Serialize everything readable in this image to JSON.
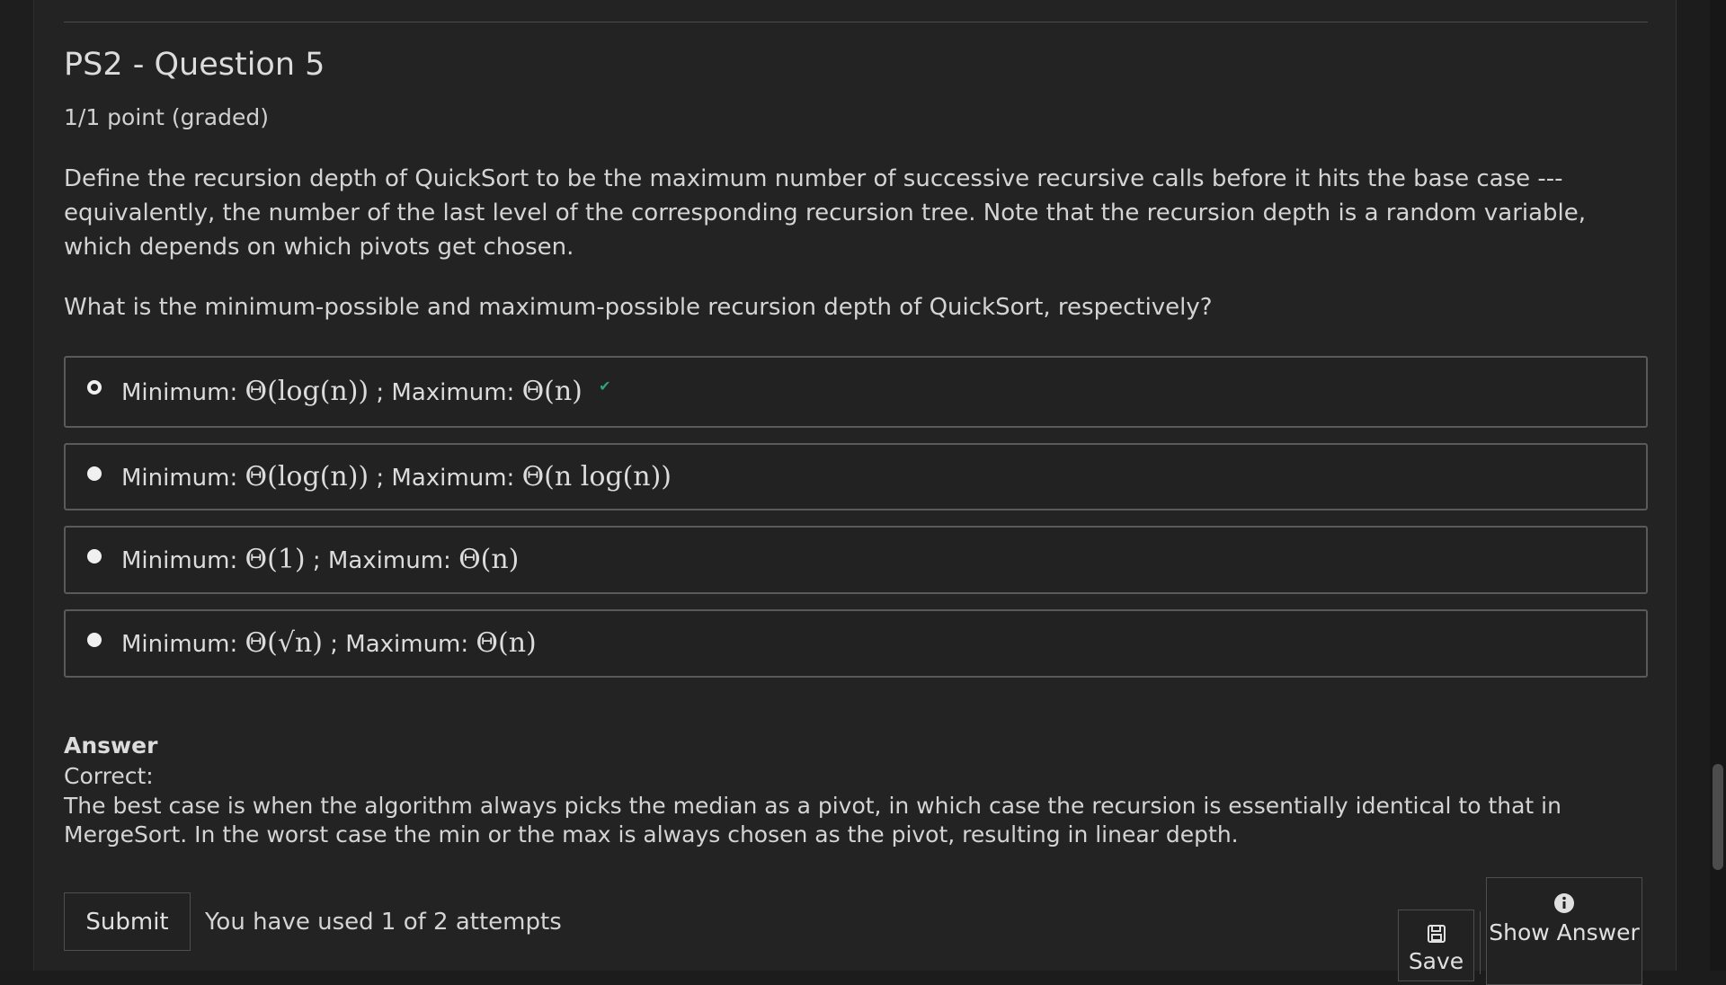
{
  "problem": {
    "title": "PS2 - Question 5",
    "score": "1/1 point (graded)",
    "prompt": "Define the recursion depth of QuickSort to be the maximum number of successive recursive calls before it hits the base case --- equivalently, the number of the last level of the corresponding recursion tree. Note that the recursion depth is a random variable, which depends on which pivots get chosen.",
    "question": "What is the minimum-possible and maximum-possible recursion depth of QuickSort, respectively?"
  },
  "choices": [
    {
      "min_prefix": "Minimum:",
      "min_math": "Θ(log(n))",
      "max_prefix": "; Maximum:",
      "max_math": "Θ(n)",
      "selected": true,
      "correct": true
    },
    {
      "min_prefix": "Minimum:",
      "min_math": "Θ(log(n))",
      "max_prefix": "; Maximum:",
      "max_math": "Θ(n log(n))",
      "selected": false,
      "correct": false
    },
    {
      "min_prefix": "Minimum:",
      "min_math": "Θ(1)",
      "max_prefix": "; Maximum:",
      "max_math": "Θ(n)",
      "selected": false,
      "correct": false
    },
    {
      "min_prefix": "Minimum:",
      "min_math": "Θ(√n)",
      "max_prefix": "; Maximum:",
      "max_math": "Θ(n)",
      "selected": false,
      "correct": false
    }
  ],
  "answer": {
    "heading": "Answer",
    "status": "Correct:",
    "explanation": "The best case is when the algorithm always picks the median as a pivot, in which case the recursion is essentially identical to that in MergeSort. In the worst case the min or the max is always chosen as the pivot, resulting in linear depth."
  },
  "actions": {
    "submit_label": "Submit",
    "attempts_text": "You have used 1 of 2 attempts",
    "save_label": "Save",
    "show_answer_label": "Show Answer",
    "save_icon": "floppy-disk-icon",
    "show_answer_icon": "info-circle-icon"
  },
  "colors": {
    "background": "#232323",
    "text": "#d4d4d4",
    "correct": "#2ea37a"
  }
}
